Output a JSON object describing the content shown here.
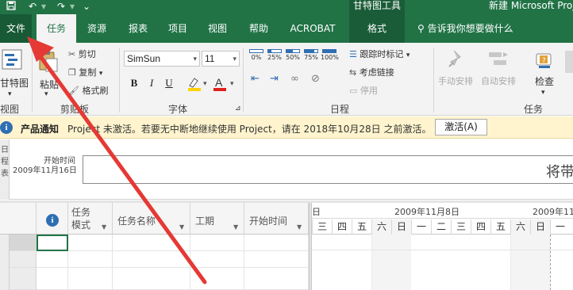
{
  "title_bar": {
    "context_group": "甘特图工具",
    "document_title": "新建 Microsoft Project",
    "icons": [
      "save-icon",
      "undo-icon",
      "redo-icon",
      "customize-quick-access-icon"
    ]
  },
  "tabs": [
    {
      "label": "文件"
    },
    {
      "label": "任务"
    },
    {
      "label": "资源"
    },
    {
      "label": "报表"
    },
    {
      "label": "项目"
    },
    {
      "label": "视图"
    },
    {
      "label": "帮助"
    },
    {
      "label": "ACROBAT"
    },
    {
      "label": "格式"
    }
  ],
  "tell_me": "告诉我你想要做什么",
  "ribbon": {
    "view_group": {
      "button": "甘特图",
      "label": "视图"
    },
    "clipboard": {
      "paste": "粘贴",
      "cut": "剪切",
      "copy": "复制",
      "format_painter": "格式刷",
      "label": "剪贴板"
    },
    "font": {
      "font_name": "SimSun",
      "font_size": "11",
      "bold": "B",
      "italic": "I",
      "underline": "U",
      "label": "字体"
    },
    "schedule": {
      "percents": [
        "0%",
        "25%",
        "50%",
        "75%",
        "100%"
      ],
      "mark_on_track": "跟踪时标记",
      "respect_links": "考虑链接",
      "inactivate": "停用",
      "label": "日程"
    },
    "tasks": {
      "manual": "手动安排",
      "auto": "自动安排",
      "inspect": "检查",
      "label": "任务"
    }
  },
  "notice": {
    "title": "产品通知",
    "message": "Project 未激活。若要无中断地继续使用 Project，请在 2018年10月28日 之前激活。",
    "button": "激活(A)"
  },
  "timeline": {
    "side_label": "日程表",
    "start_label": "开始时间",
    "start_date": "2009年11月16日",
    "box_text": "将带"
  },
  "grid": {
    "columns": [
      {
        "label": "任务模式",
        "line1": "任务",
        "line2": "模式"
      },
      {
        "label": "任务名称"
      },
      {
        "label": "工期"
      },
      {
        "label": "开始时间"
      }
    ]
  },
  "gantt": {
    "weeks": [
      "日",
      "2009年11月8日",
      "2009年11"
    ],
    "days": [
      "三",
      "四",
      "五",
      "六",
      "日",
      "一",
      "二",
      "三",
      "四",
      "五",
      "六",
      "日",
      "一"
    ]
  },
  "colors": {
    "brand": "#217346",
    "annotation_arrow": "#e53935",
    "notice_bg": "#fff4ce"
  }
}
